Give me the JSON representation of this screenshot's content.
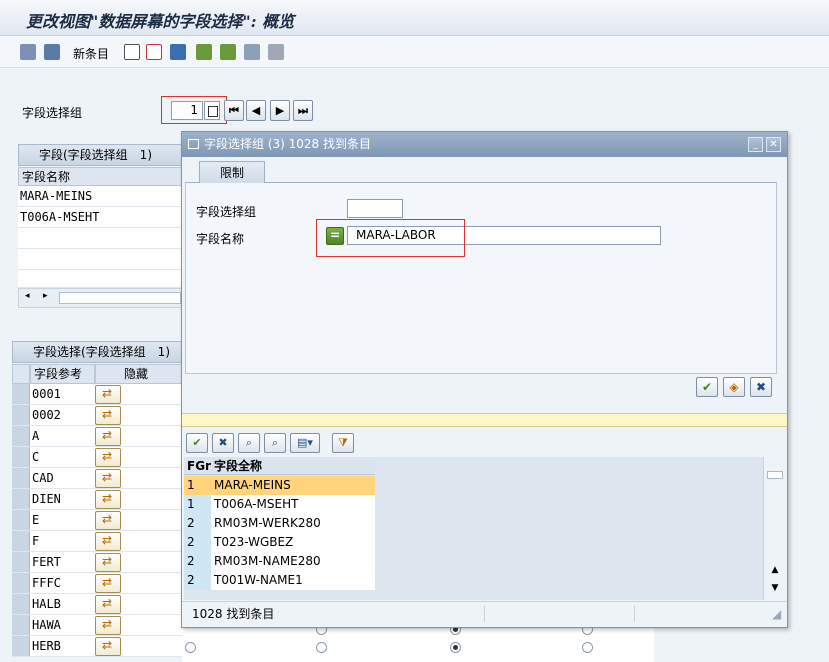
{
  "window": {
    "title": "更改视图\"数据屏幕的字段选择\": 概览"
  },
  "toolbar": {
    "new_entries_label": "新条目"
  },
  "selection": {
    "group_label": "字段选择组",
    "group_value": "1"
  },
  "panel1": {
    "header": "字段(字段选择组　1)",
    "column": "字段名称",
    "rows": [
      "MARA-MEINS",
      "T006A-MSEHT"
    ]
  },
  "panel2": {
    "header": "字段选择(字段选择组　1)",
    "columns": [
      "字段参考",
      "隐藏"
    ],
    "rows": [
      "0001",
      "0002",
      "A",
      "C",
      "CAD",
      "DIEN",
      "E",
      "F",
      "FERT",
      "FFFC",
      "HALB",
      "HAWA",
      "HERB"
    ]
  },
  "dialog": {
    "title": "字段选择组 (3) 1028 找到条目",
    "tab_label": "限制",
    "field_group_label": "字段选择组",
    "field_group_value": "",
    "field_name_label": "字段名称",
    "field_name_value": "MARA-LABOR",
    "operator_symbol": "=",
    "results": {
      "columns": [
        "FGr",
        "字段全称"
      ],
      "rows": [
        {
          "fgr": "1",
          "name": "MARA-MEINS"
        },
        {
          "fgr": "1",
          "name": "T006A-MSEHT"
        },
        {
          "fgr": "2",
          "name": "RM03M-WERK280"
        },
        {
          "fgr": "2",
          "name": "T023-WGBEZ"
        },
        {
          "fgr": "2",
          "name": "RM03M-NAME280"
        },
        {
          "fgr": "2",
          "name": "T001W-NAME1"
        }
      ]
    },
    "status": "1028 找到条目"
  },
  "colors": {
    "accent": "#ffd47a",
    "titlebar": "#8fa5c0",
    "highlight": "#e03030"
  }
}
